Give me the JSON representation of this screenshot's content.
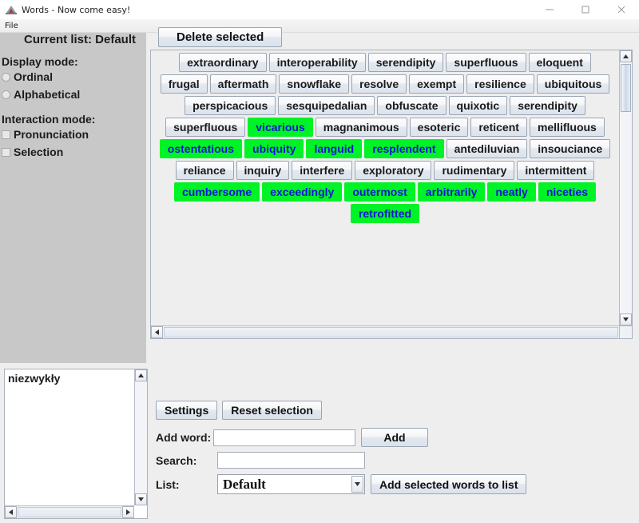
{
  "window": {
    "title": "Words - Now come easy!",
    "icon": "app-icon",
    "minimize": "–",
    "maximize": "□",
    "close": "✕"
  },
  "menubar": {
    "items": [
      {
        "label": "File"
      }
    ]
  },
  "header": {
    "current_list": "Current list: Default",
    "delete_selected": "Delete selected"
  },
  "sidebar": {
    "display_mode_heading": "Display mode:",
    "display_modes": [
      {
        "label": "Ordinal",
        "selected": false
      },
      {
        "label": "Alphabetical",
        "selected": false
      }
    ],
    "interaction_mode_heading": "Interaction mode:",
    "interaction_modes": [
      {
        "label": "Pronunciation",
        "checked": false
      },
      {
        "label": "Selection",
        "checked": false
      }
    ]
  },
  "word_panel": {
    "selected_color": "#00f326",
    "selected_text_color": "#1414d6",
    "rows": [
      [
        {
          "label": "extraordinary",
          "selected": false
        },
        {
          "label": "interoperability",
          "selected": false
        },
        {
          "label": "serendipity",
          "selected": false
        },
        {
          "label": "superfluous",
          "selected": false
        },
        {
          "label": "eloquent",
          "selected": false
        }
      ],
      [
        {
          "label": "frugal",
          "selected": false
        },
        {
          "label": "aftermath",
          "selected": false
        },
        {
          "label": "snowflake",
          "selected": false
        },
        {
          "label": "resolve",
          "selected": false
        },
        {
          "label": "exempt",
          "selected": false
        },
        {
          "label": "resilience",
          "selected": false
        },
        {
          "label": "ubiquitous",
          "selected": false
        }
      ],
      [
        {
          "label": "perspicacious",
          "selected": false
        },
        {
          "label": "sesquipedalian",
          "selected": false
        },
        {
          "label": "obfuscate",
          "selected": false
        },
        {
          "label": "quixotic",
          "selected": false
        },
        {
          "label": "serendipity",
          "selected": false
        }
      ],
      [
        {
          "label": "superfluous",
          "selected": false
        },
        {
          "label": "vicarious",
          "selected": true
        },
        {
          "label": "magnanimous",
          "selected": false
        },
        {
          "label": "esoteric",
          "selected": false
        },
        {
          "label": "reticent",
          "selected": false
        },
        {
          "label": "mellifluous",
          "selected": false
        }
      ],
      [
        {
          "label": "ostentatious",
          "selected": true
        },
        {
          "label": "ubiquity",
          "selected": true
        },
        {
          "label": "languid",
          "selected": true
        },
        {
          "label": "resplendent",
          "selected": true
        },
        {
          "label": "antediluvian",
          "selected": false
        },
        {
          "label": "insouciance",
          "selected": false
        }
      ],
      [
        {
          "label": "reliance",
          "selected": false
        },
        {
          "label": "inquiry",
          "selected": false
        },
        {
          "label": "interfere",
          "selected": false
        },
        {
          "label": "exploratory",
          "selected": false
        },
        {
          "label": "rudimentary",
          "selected": false
        },
        {
          "label": "intermittent",
          "selected": false
        }
      ],
      [
        {
          "label": "cumbersome",
          "selected": true
        },
        {
          "label": "exceedingly",
          "selected": true
        },
        {
          "label": "outermost",
          "selected": true
        },
        {
          "label": "arbitrarily",
          "selected": true
        },
        {
          "label": "neatly",
          "selected": true
        },
        {
          "label": "niceties",
          "selected": true
        }
      ],
      [
        {
          "label": "retrofitted",
          "selected": true
        }
      ]
    ]
  },
  "text_area": {
    "value": "niezwykły"
  },
  "form": {
    "settings_label": "Settings",
    "reset_selection_label": "Reset selection",
    "add_word_label": "Add word:",
    "add_word_value": "",
    "add_word_placeholder": "",
    "add_button_label": "Add",
    "search_label": "Search:",
    "search_value": "",
    "search_placeholder": "",
    "list_label": "List:",
    "list_selected": "Default",
    "list_options": [
      "Default"
    ],
    "add_selected_label": "Add selected words to list"
  },
  "scroll": {
    "up_arrow": "▲",
    "down_arrow": "▼",
    "left_arrow": "◀",
    "right_arrow": "▶"
  }
}
